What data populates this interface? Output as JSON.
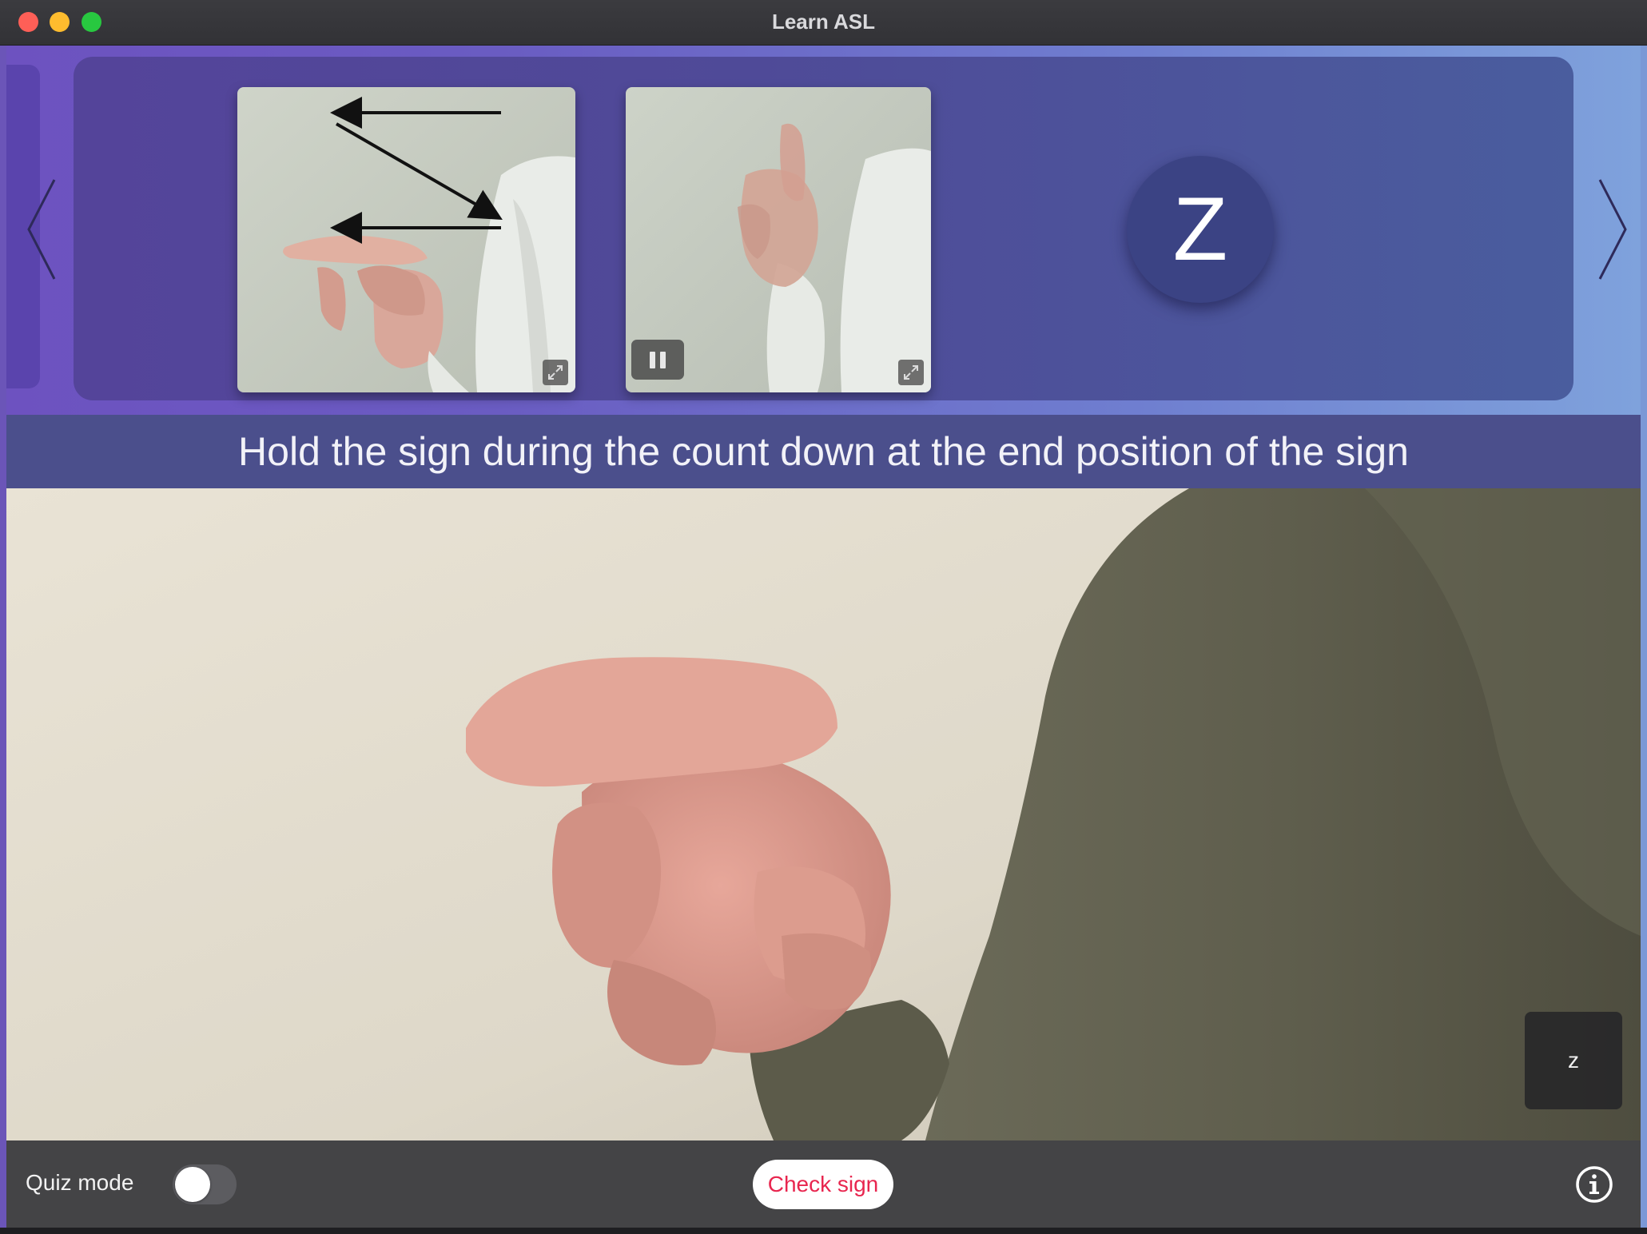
{
  "window": {
    "title": "Learn ASL"
  },
  "carousel": {
    "prev_icon": "chevron-left-icon",
    "next_icon": "chevron-right-icon",
    "cards": [
      {
        "kind": "diagram-photo",
        "expand_icon": "expand-icon"
      },
      {
        "kind": "video",
        "pause_icon": "pause-icon",
        "expand_icon": "expand-icon"
      }
    ],
    "letter": "Z"
  },
  "instruction": "Hold the sign during the count down at the end position of the sign",
  "camera": {
    "prediction": "z"
  },
  "toolbar": {
    "quiz_mode_label": "Quiz mode",
    "quiz_mode_on": false,
    "check_sign_label": "Check sign",
    "info_icon": "info-icon"
  },
  "colors": {
    "accent_red": "#e8264f",
    "panel_purple": "#54449a",
    "letter_circle": "#3b4384"
  }
}
